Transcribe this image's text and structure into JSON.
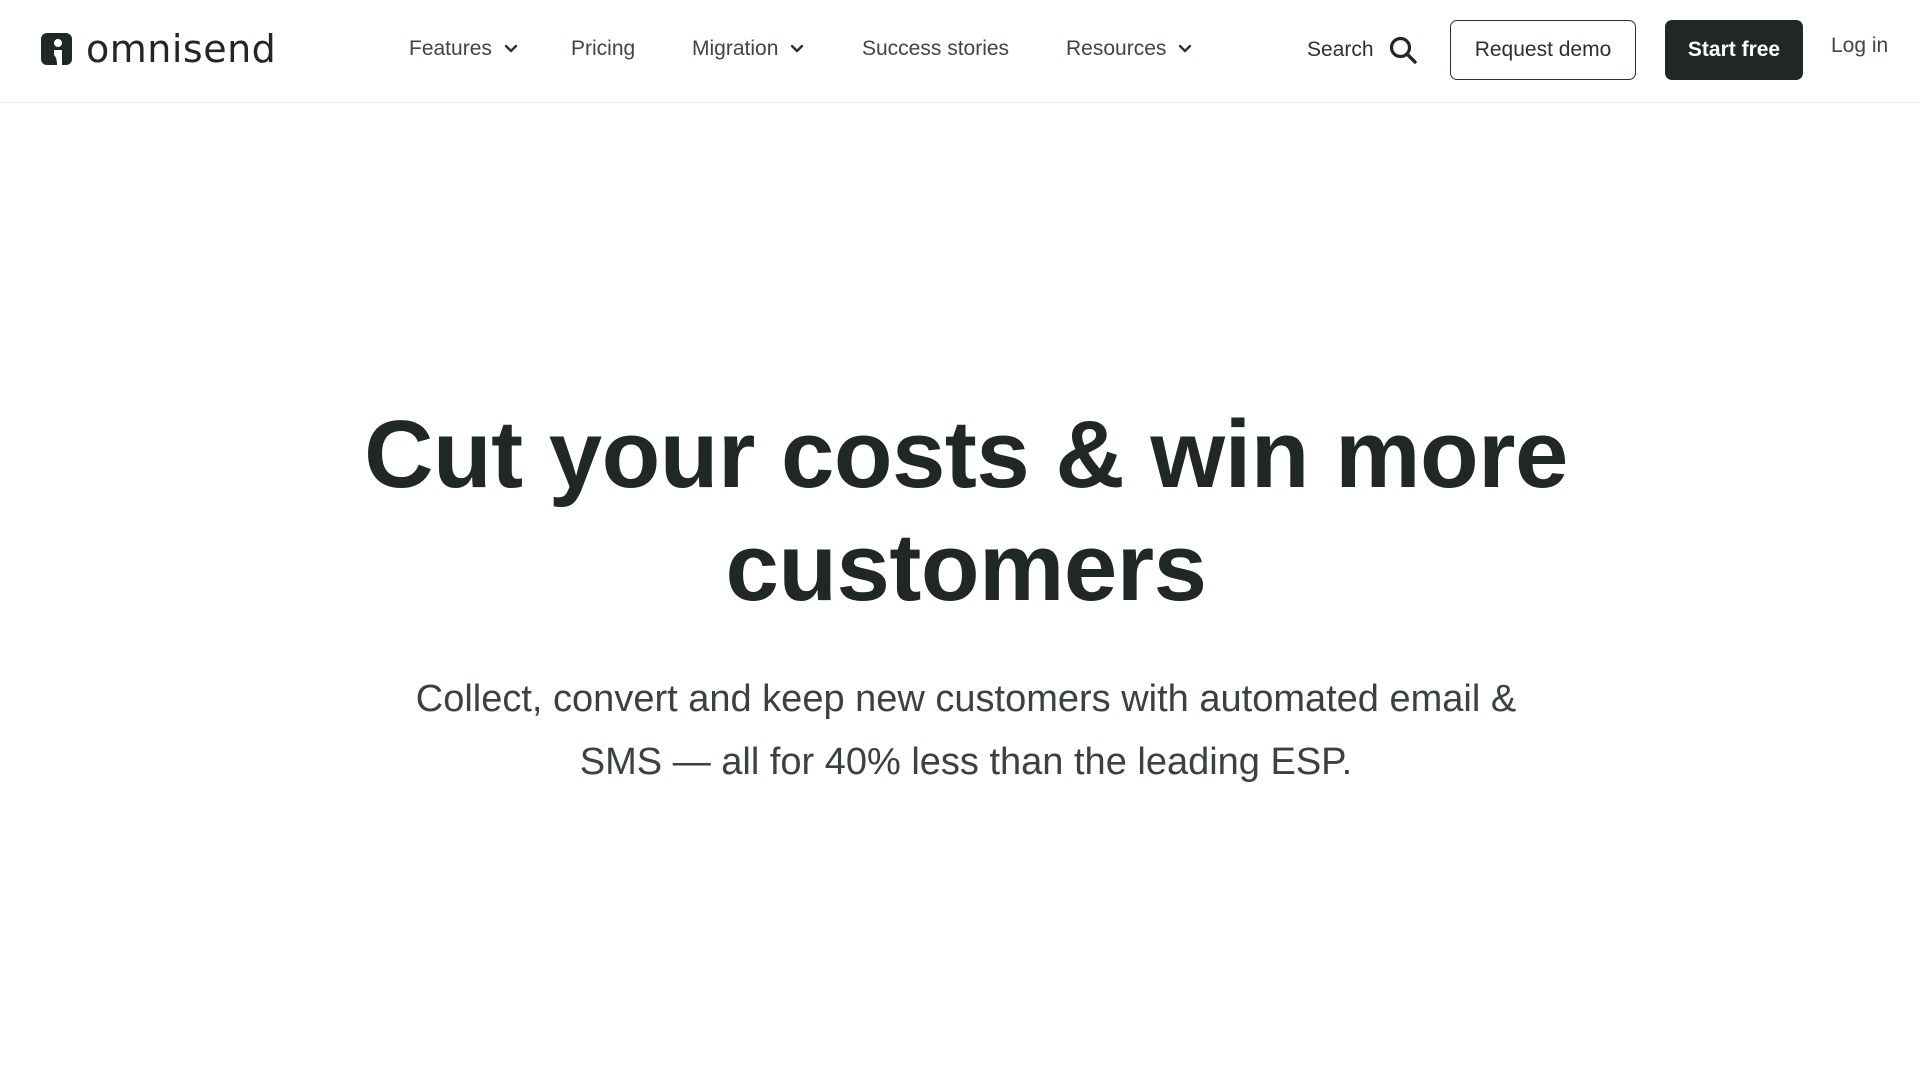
{
  "brand": {
    "name": "omnisend",
    "logo_icon": "omnisend-logo-icon"
  },
  "nav": {
    "items": [
      {
        "label": "Features",
        "has_dropdown": true
      },
      {
        "label": "Pricing",
        "has_dropdown": false
      },
      {
        "label": "Migration",
        "has_dropdown": true
      },
      {
        "label": "Success stories",
        "has_dropdown": false
      },
      {
        "label": "Resources",
        "has_dropdown": true
      }
    ],
    "search_label": "Search",
    "search_icon": "search-icon",
    "request_demo_label": "Request demo",
    "start_free_label": "Start free",
    "login_label": "Log in"
  },
  "hero": {
    "title_lines": [
      "Cut your costs & win more",
      "customers"
    ],
    "subtitle_lines": [
      "Collect, convert and keep new customers with automated email &",
      "SMS — all for 40% less than the leading ESP."
    ]
  },
  "colors": {
    "text_primary": "#212626",
    "primary_button_bg": "#212626",
    "primary_button_text": "#ffffff",
    "background": "#ffffff"
  }
}
